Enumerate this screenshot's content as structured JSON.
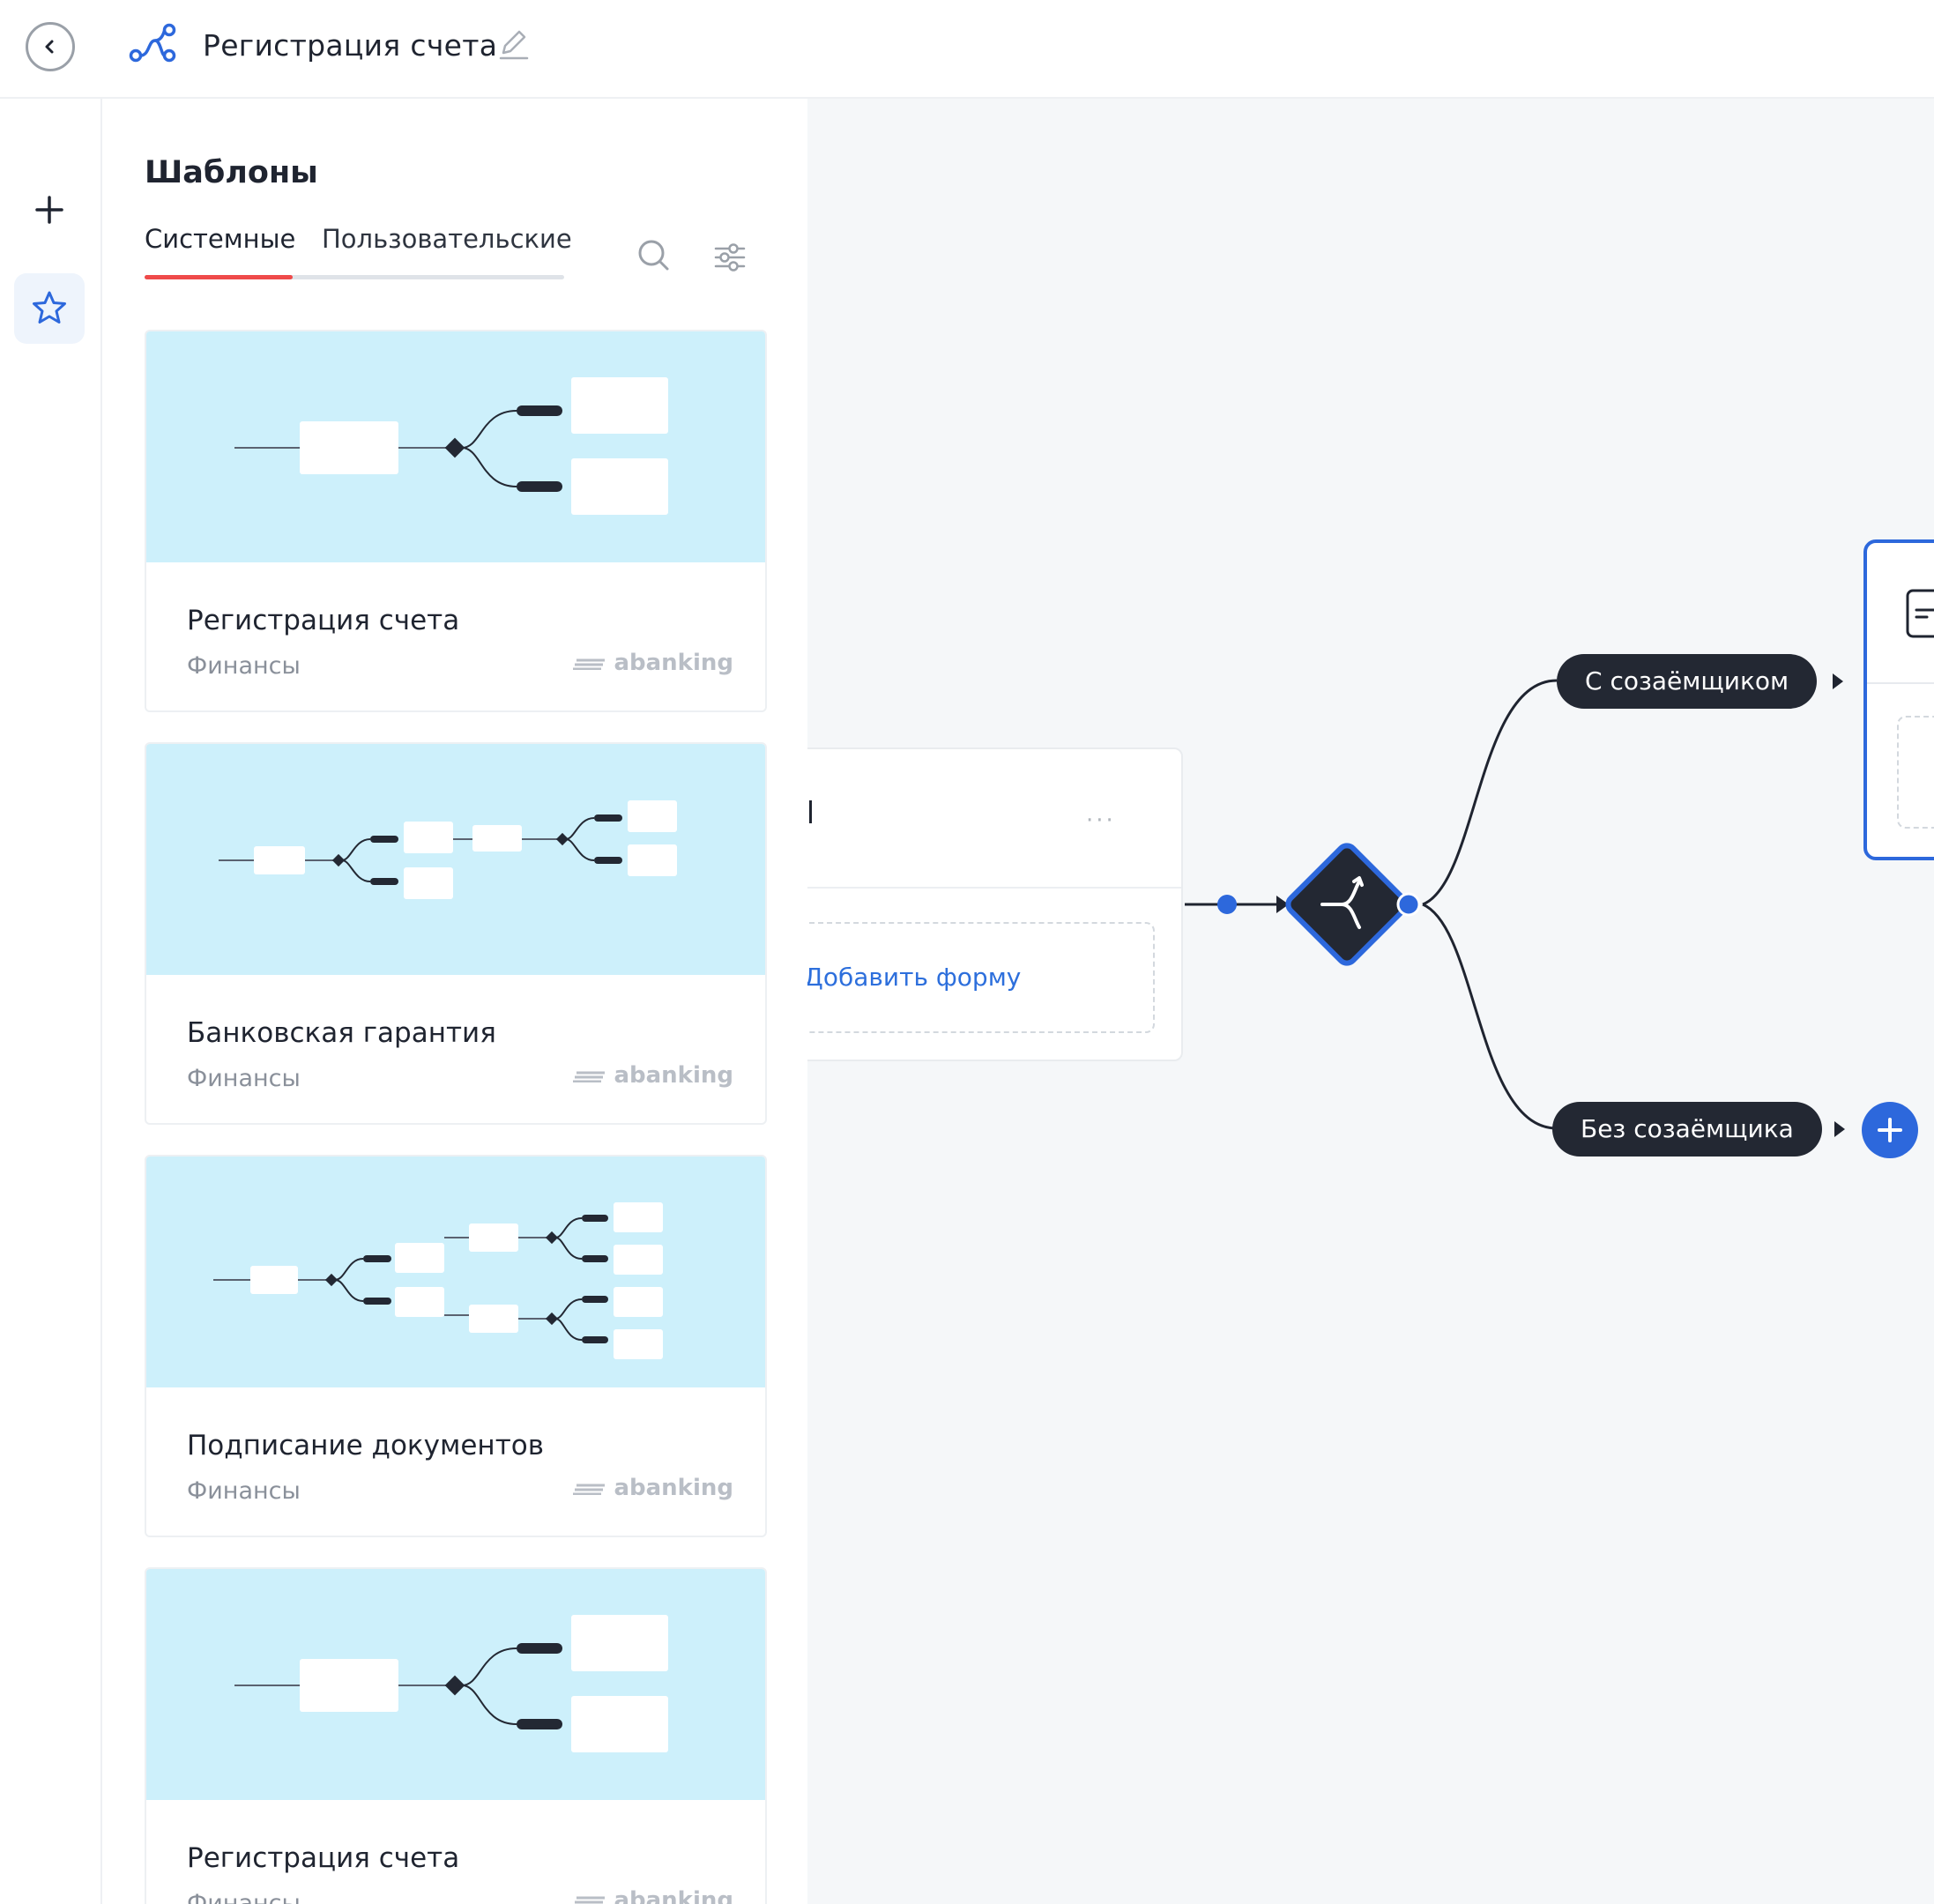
{
  "header": {
    "title": "Регистрация счета"
  },
  "templates": {
    "title": "Шаблоны",
    "tabs": [
      {
        "label": "Системные",
        "active": true
      },
      {
        "label": "Пользовательские",
        "active": false
      }
    ],
    "cards": [
      {
        "name": "Регистрация счета",
        "category": "Финансы",
        "brand": "abanking"
      },
      {
        "name": "Банковская гарантия",
        "category": "Финансы",
        "brand": "abanking"
      },
      {
        "name": "Подписание документов",
        "category": "Финансы",
        "brand": "abanking"
      },
      {
        "name": "Регистрация счета",
        "category": "Финансы",
        "brand": "abanking"
      }
    ]
  },
  "canvas": {
    "node": {
      "add_form_label": "Добавить форму",
      "menu_dots": "···"
    },
    "branches": [
      {
        "label": "С созаёмщиком"
      },
      {
        "label": "Без созаёмщика"
      }
    ]
  },
  "icons": {
    "back": "chevron-left-icon",
    "process": "flow-icon",
    "edit": "pencil-icon",
    "add": "plus-icon",
    "favorites": "star-icon",
    "search": "search-icon",
    "filter": "sliders-icon",
    "split": "split-arrows-icon"
  },
  "colors": {
    "accent": "#2d68dc",
    "tab_indicator": "#ef4a4a",
    "preview_bg": "#cdf0fb",
    "pill_bg": "#232833",
    "canvas_bg": "#f5f7f9"
  }
}
